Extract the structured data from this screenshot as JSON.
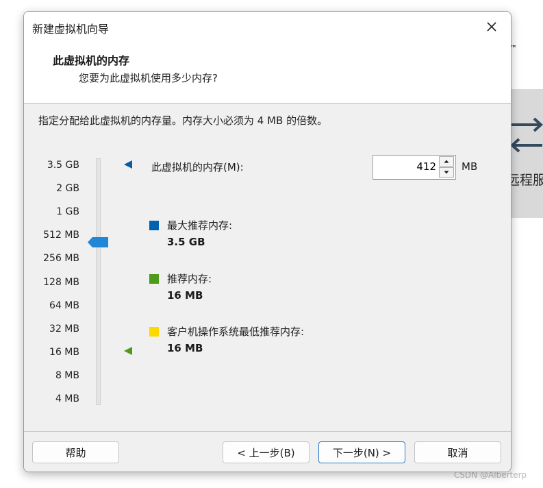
{
  "background": {
    "trademark": "™",
    "partial_text": "远程服"
  },
  "watermark": "CSDN @Alberterp",
  "dialog": {
    "title": "新建虚拟机向导",
    "header_title": "此虚拟机的内存",
    "header_subtitle": "您要为此虚拟机使用多少内存?",
    "description": "指定分配给此虚拟机的内存量。内存大小必须为 4 MB 的倍数。",
    "scale_ticks": [
      "3.5 GB",
      "2 GB",
      "1 GB",
      "512 MB",
      "256 MB",
      "128 MB",
      "64 MB",
      "32 MB",
      "16 MB",
      "8 MB",
      "4 MB"
    ],
    "memory_label": "此虚拟机的内存(M):",
    "memory_value": "412",
    "memory_unit": "MB",
    "legend": [
      {
        "label": "最大推荐内存:",
        "value": "3.5 GB",
        "color": "#0063b1"
      },
      {
        "label": "推荐内存:",
        "value": "16 MB",
        "color": "#4e9a1a"
      },
      {
        "label": "客户机操作系统最低推荐内存:",
        "value": "16 MB",
        "color": "#ffd800"
      }
    ],
    "buttons": {
      "help": "帮助",
      "back": "< 上一步(B)",
      "next": "下一步(N) >",
      "cancel": "取消"
    }
  },
  "colors": {
    "slider_thumb": "#1f86d8",
    "max_marker": "#0e5aa0",
    "recommended_marker": "#4e9a1a"
  }
}
